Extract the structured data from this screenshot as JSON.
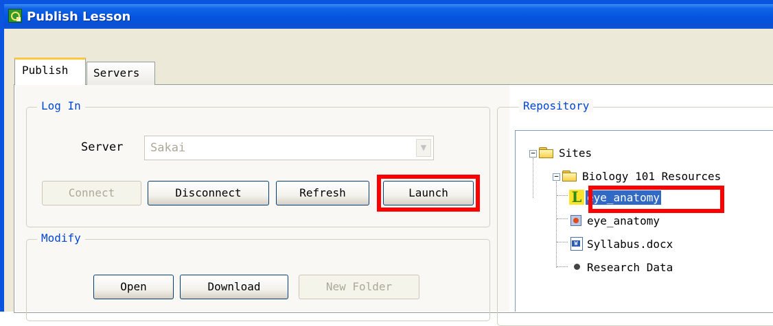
{
  "window": {
    "title": "Publish Lesson"
  },
  "tabs": [
    {
      "label": "Publish",
      "active": true
    },
    {
      "label": "Servers",
      "active": false
    }
  ],
  "login": {
    "legend": "Log In",
    "server_label": "Server",
    "server_value": "Sakai",
    "buttons": {
      "connect": "Connect",
      "disconnect": "Disconnect",
      "refresh": "Refresh",
      "launch": "Launch"
    }
  },
  "modify": {
    "legend": "Modify",
    "buttons": {
      "open": "Open",
      "download": "Download",
      "new_folder": "New Folder"
    }
  },
  "repository": {
    "legend": "Repository",
    "tree": {
      "sites": "Sites",
      "course": "Biology 101 Resources",
      "items": [
        {
          "label": "eye_anatomy",
          "icon": "lesson-icon",
          "selected": true
        },
        {
          "label": "eye_anatomy",
          "icon": "media-icon",
          "selected": false
        },
        {
          "label": "Syllabus.docx",
          "icon": "word-doc-icon",
          "selected": false
        },
        {
          "label": "Research Data",
          "icon": "bullet-icon",
          "selected": false
        }
      ]
    }
  },
  "colors": {
    "titlebar": "#0554e0",
    "legend_text": "#0046d5",
    "highlight": "#ff0000",
    "selection": "#316ac5"
  }
}
